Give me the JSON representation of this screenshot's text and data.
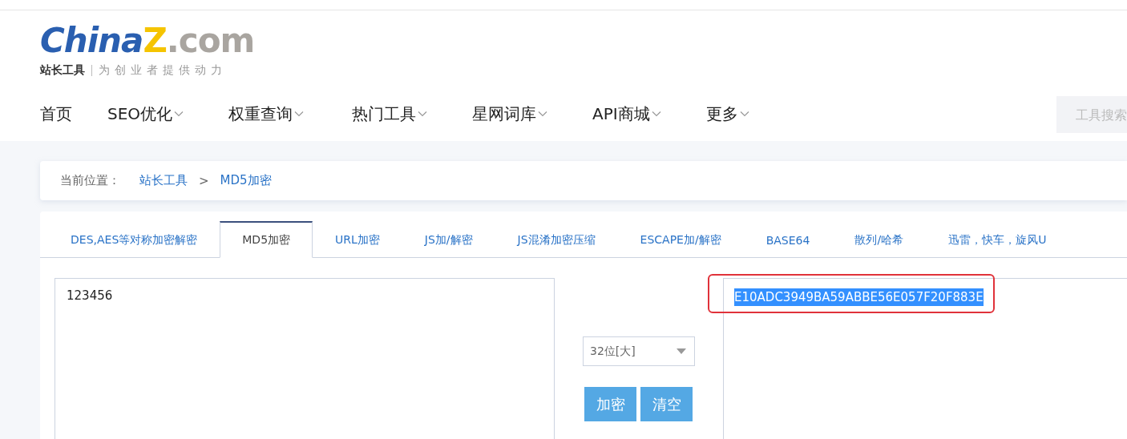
{
  "logo": {
    "parts": [
      "China",
      "Z",
      ".com"
    ],
    "tagline_bold": "站长工具",
    "tagline": "为创业者提供动力"
  },
  "nav": [
    {
      "label": "首页",
      "has_menu": false
    },
    {
      "label": "SEO优化",
      "has_menu": true
    },
    {
      "label": "权重查询",
      "has_menu": true
    },
    {
      "label": "热门工具",
      "has_menu": true
    },
    {
      "label": "星网词库",
      "has_menu": true
    },
    {
      "label": "API商城",
      "has_menu": true
    },
    {
      "label": "更多",
      "has_menu": true
    }
  ],
  "search": {
    "placeholder": "工具搜索"
  },
  "breadcrumb": {
    "label": "当前位置：",
    "items": [
      "站长工具",
      "MD5加密"
    ],
    "separator": ">"
  },
  "tabs": [
    {
      "label": "DES,AES等对称加密解密",
      "selected": false
    },
    {
      "label": "MD5加密",
      "selected": true
    },
    {
      "label": "URL加密",
      "selected": false
    },
    {
      "label": "JS加/解密",
      "selected": false
    },
    {
      "label": "JS混淆加密压缩",
      "selected": false
    },
    {
      "label": "ESCAPE加/解密",
      "selected": false
    },
    {
      "label": "BASE64",
      "selected": false
    },
    {
      "label": "散列/哈希",
      "selected": false
    },
    {
      "label": "迅雷，快车，旋风U",
      "selected": false
    }
  ],
  "input": {
    "value": "123456"
  },
  "mode_select": {
    "value": "32位[大]"
  },
  "buttons": [
    "加密",
    "清空"
  ],
  "output": {
    "value": "E10ADC3949BA59ABBE56E057F20F883E",
    "selected": true,
    "highlighted": true
  }
}
